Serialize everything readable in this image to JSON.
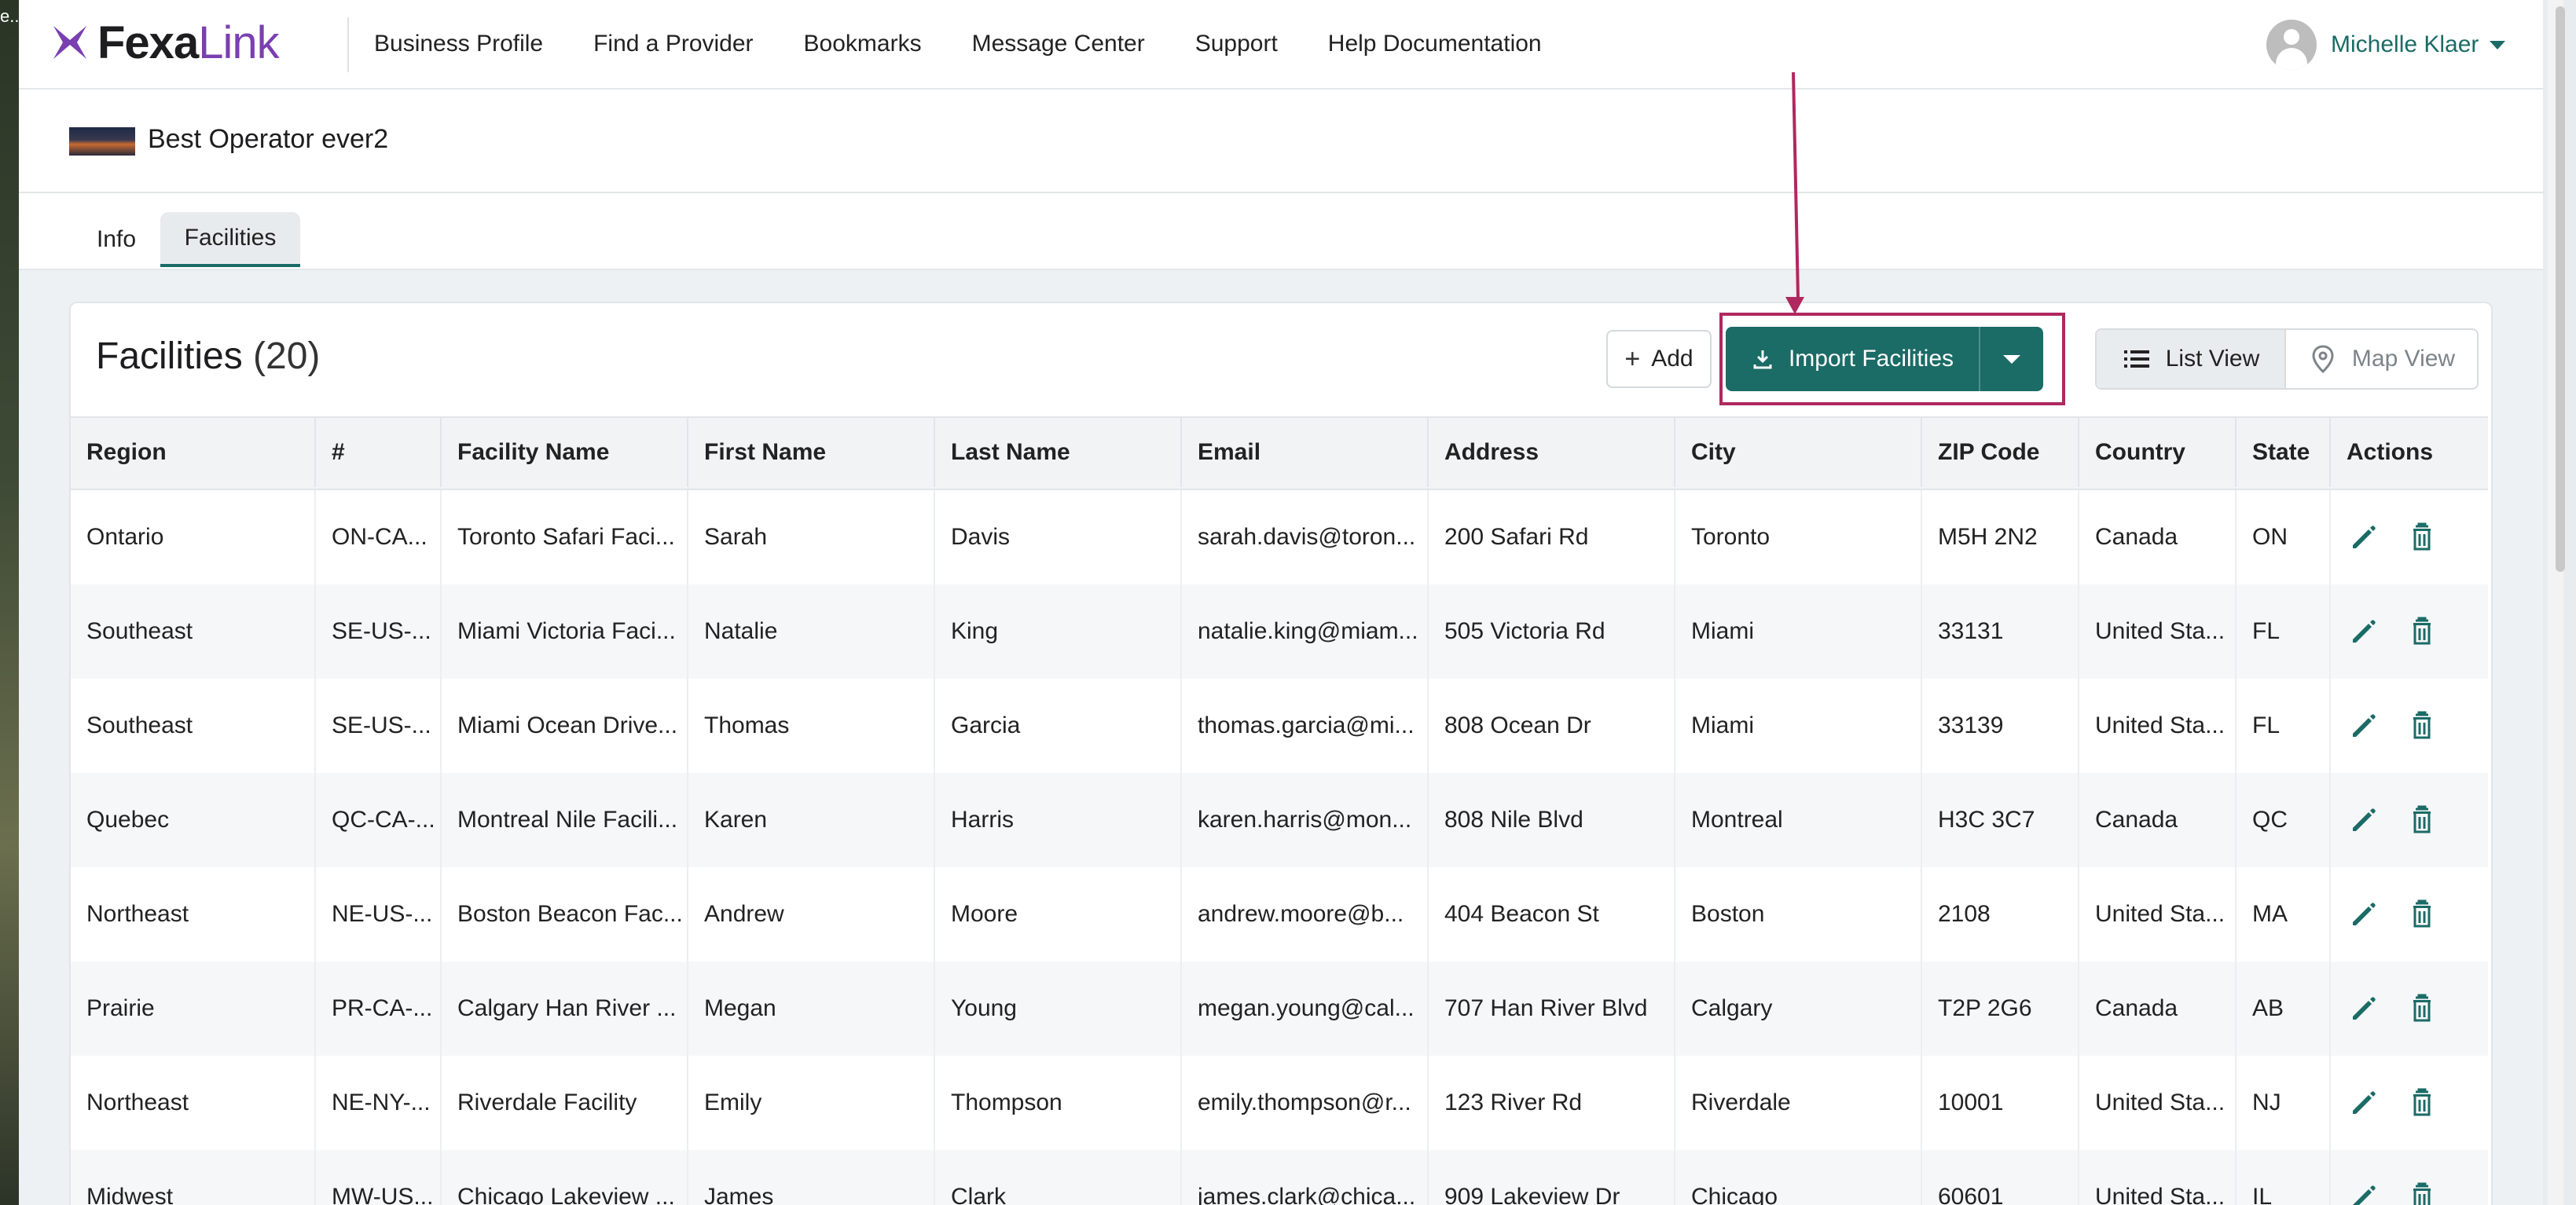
{
  "background": {
    "edge_text": "e..."
  },
  "nav": {
    "logo_fexa": "Fexa",
    "logo_link": "Link",
    "links": [
      "Business Profile",
      "Find a Provider",
      "Bookmarks",
      "Message Center",
      "Support",
      "Help Documentation"
    ],
    "user_name": "Michelle Klaer"
  },
  "profile": {
    "name": "Best Operator ever2"
  },
  "tabs": {
    "info": "Info",
    "facilities": "Facilities"
  },
  "card": {
    "title": "Facilities",
    "count": "(20)",
    "add_label": "Add",
    "import_label": "Import Facilities",
    "list_view_label": "List View",
    "map_view_label": "Map View"
  },
  "colors": {
    "primary": "#1b6b66",
    "highlight": "#b0285f",
    "brand_purple": "#7a3fb0"
  },
  "table": {
    "columns": [
      "Region",
      "#",
      "Facility Name",
      "First Name",
      "Last Name",
      "Email",
      "Address",
      "City",
      "ZIP Code",
      "Country",
      "State",
      "Actions"
    ],
    "rows": [
      [
        "Ontario",
        "ON-CA...",
        "Toronto Safari Faci...",
        "Sarah",
        "Davis",
        "sarah.davis@toron...",
        "200 Safari Rd",
        "Toronto",
        "M5H 2N2",
        "Canada",
        "ON"
      ],
      [
        "Southeast",
        "SE-US-...",
        "Miami Victoria Faci...",
        "Natalie",
        "King",
        "natalie.king@miam...",
        "505 Victoria Rd",
        "Miami",
        "33131",
        "United Sta...",
        "FL"
      ],
      [
        "Southeast",
        "SE-US-...",
        "Miami Ocean Drive...",
        "Thomas",
        "Garcia",
        "thomas.garcia@mi...",
        "808 Ocean Dr",
        "Miami",
        "33139",
        "United Sta...",
        "FL"
      ],
      [
        "Quebec",
        "QC-CA-...",
        "Montreal Nile Facili...",
        "Karen",
        "Harris",
        "karen.harris@mon...",
        "808 Nile Blvd",
        "Montreal",
        "H3C 3C7",
        "Canada",
        "QC"
      ],
      [
        "Northeast",
        "NE-US-...",
        "Boston Beacon Fac...",
        "Andrew",
        "Moore",
        "andrew.moore@b...",
        "404 Beacon St",
        "Boston",
        "2108",
        "United Sta...",
        "MA"
      ],
      [
        "Prairie",
        "PR-CA-...",
        "Calgary Han River ...",
        "Megan",
        "Young",
        "megan.young@cal...",
        "707 Han River Blvd",
        "Calgary",
        "T2P 2G6",
        "Canada",
        "AB"
      ],
      [
        "Northeast",
        "NE-NY-...",
        "Riverdale Facility",
        "Emily",
        "Thompson",
        "emily.thompson@r...",
        "123 River Rd",
        "Riverdale",
        "10001",
        "United Sta...",
        "NJ"
      ],
      [
        "Midwest",
        "MW-US...",
        "Chicago Lakeview ...",
        "James",
        "Clark",
        "james.clark@chica...",
        "909 Lakeview Dr",
        "Chicago",
        "60601",
        "United Sta...",
        "IL"
      ]
    ]
  }
}
